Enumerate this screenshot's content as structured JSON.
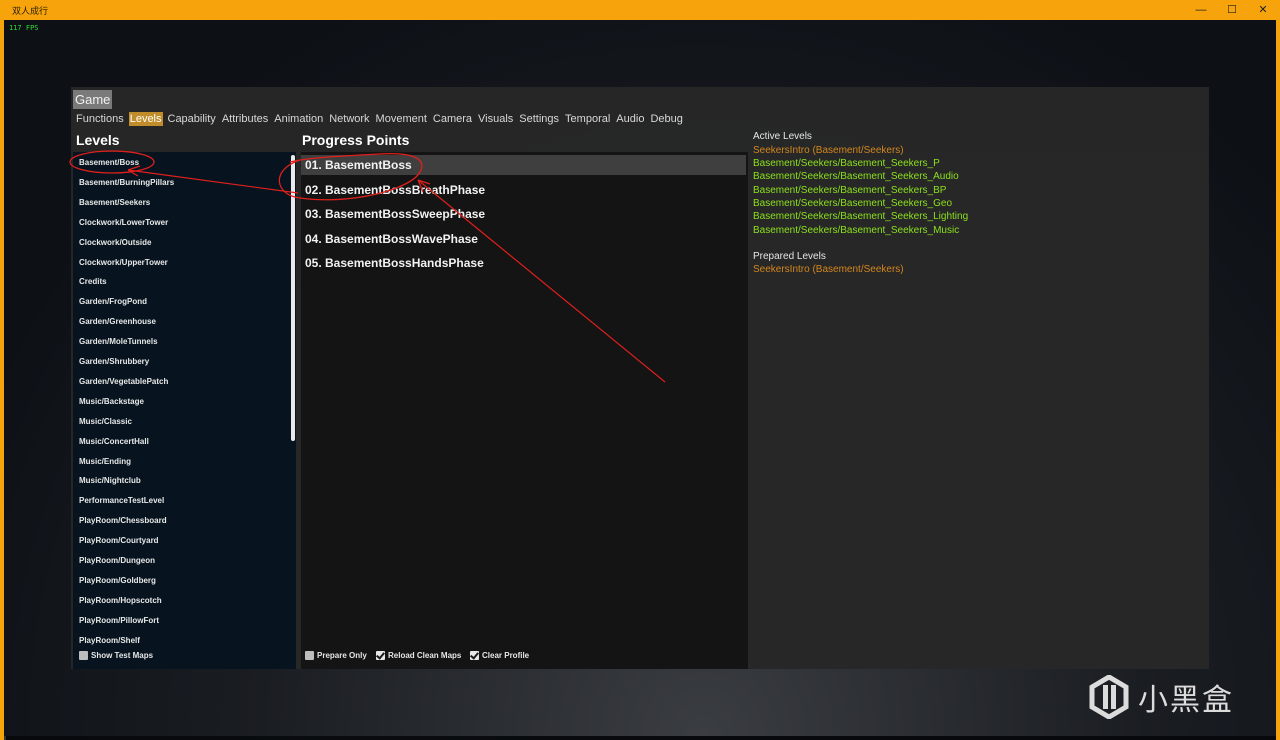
{
  "window": {
    "title": "双人成行",
    "fps": "117 FPS"
  },
  "panel": {
    "header": "Game",
    "tabs": [
      {
        "label": "Functions",
        "active": false
      },
      {
        "label": "Levels",
        "active": true
      },
      {
        "label": "Capability",
        "active": false
      },
      {
        "label": "Attributes",
        "active": false
      },
      {
        "label": "Animation",
        "active": false
      },
      {
        "label": "Network",
        "active": false
      },
      {
        "label": "Movement",
        "active": false
      },
      {
        "label": "Camera",
        "active": false
      },
      {
        "label": "Visuals",
        "active": false
      },
      {
        "label": "Settings",
        "active": false
      },
      {
        "label": "Temporal",
        "active": false
      },
      {
        "label": "Audio",
        "active": false
      },
      {
        "label": "Debug",
        "active": false
      }
    ]
  },
  "levels": {
    "heading": "Levels",
    "items": [
      "Basement/Boss",
      "Basement/BurningPillars",
      "Basement/Seekers",
      "Clockwork/LowerTower",
      "Clockwork/Outside",
      "Clockwork/UpperTower",
      "Credits",
      "Garden/FrogPond",
      "Garden/Greenhouse",
      "Garden/MoleTunnels",
      "Garden/Shrubbery",
      "Garden/VegetablePatch",
      "Music/Backstage",
      "Music/Classic",
      "Music/ConcertHall",
      "Music/Ending",
      "Music/Nightclub",
      "PerformanceTestLevel",
      "PlayRoom/Chessboard",
      "PlayRoom/Courtyard",
      "PlayRoom/Dungeon",
      "PlayRoom/Goldberg",
      "PlayRoom/Hopscotch",
      "PlayRoom/PillowFort",
      "PlayRoom/Shelf"
    ],
    "show_test_maps": {
      "label": "Show Test Maps",
      "checked": false
    }
  },
  "progress_points": {
    "heading": "Progress Points",
    "items": [
      "01. BasementBoss",
      "02. BasementBossBreathPhase",
      "03. BasementBossSweepPhase",
      "04. BasementBossWavePhase",
      "05. BasementBossHandsPhase"
    ],
    "selected_index": 0,
    "options": [
      {
        "label": "Prepare Only",
        "checked": false
      },
      {
        "label": "Reload Clean Maps",
        "checked": true
      },
      {
        "label": "Clear Profile",
        "checked": true
      }
    ]
  },
  "active_levels": {
    "heading": "Active Levels",
    "intro": "SeekersIntro (Basement/Seekers)",
    "items": [
      "Basement/Seekers/Basement_Seekers_P",
      "Basement/Seekers/Basement_Seekers_Audio",
      "Basement/Seekers/Basement_Seekers_BP",
      "Basement/Seekers/Basement_Seekers_Geo",
      "Basement/Seekers/Basement_Seekers_Lighting",
      "Basement/Seekers/Basement_Seekers_Music"
    ]
  },
  "prepared_levels": {
    "heading": "Prepared Levels",
    "items": [
      "SeekersIntro (Basement/Seekers)"
    ]
  },
  "watermark": {
    "text": "小黑盒"
  },
  "colors": {
    "titlebar": "#f7a30c",
    "active_tab": "#c08d2a",
    "active_level_green": "#8be01c",
    "intro_orange": "#d4861e",
    "annotation_red": "#e0201c"
  }
}
